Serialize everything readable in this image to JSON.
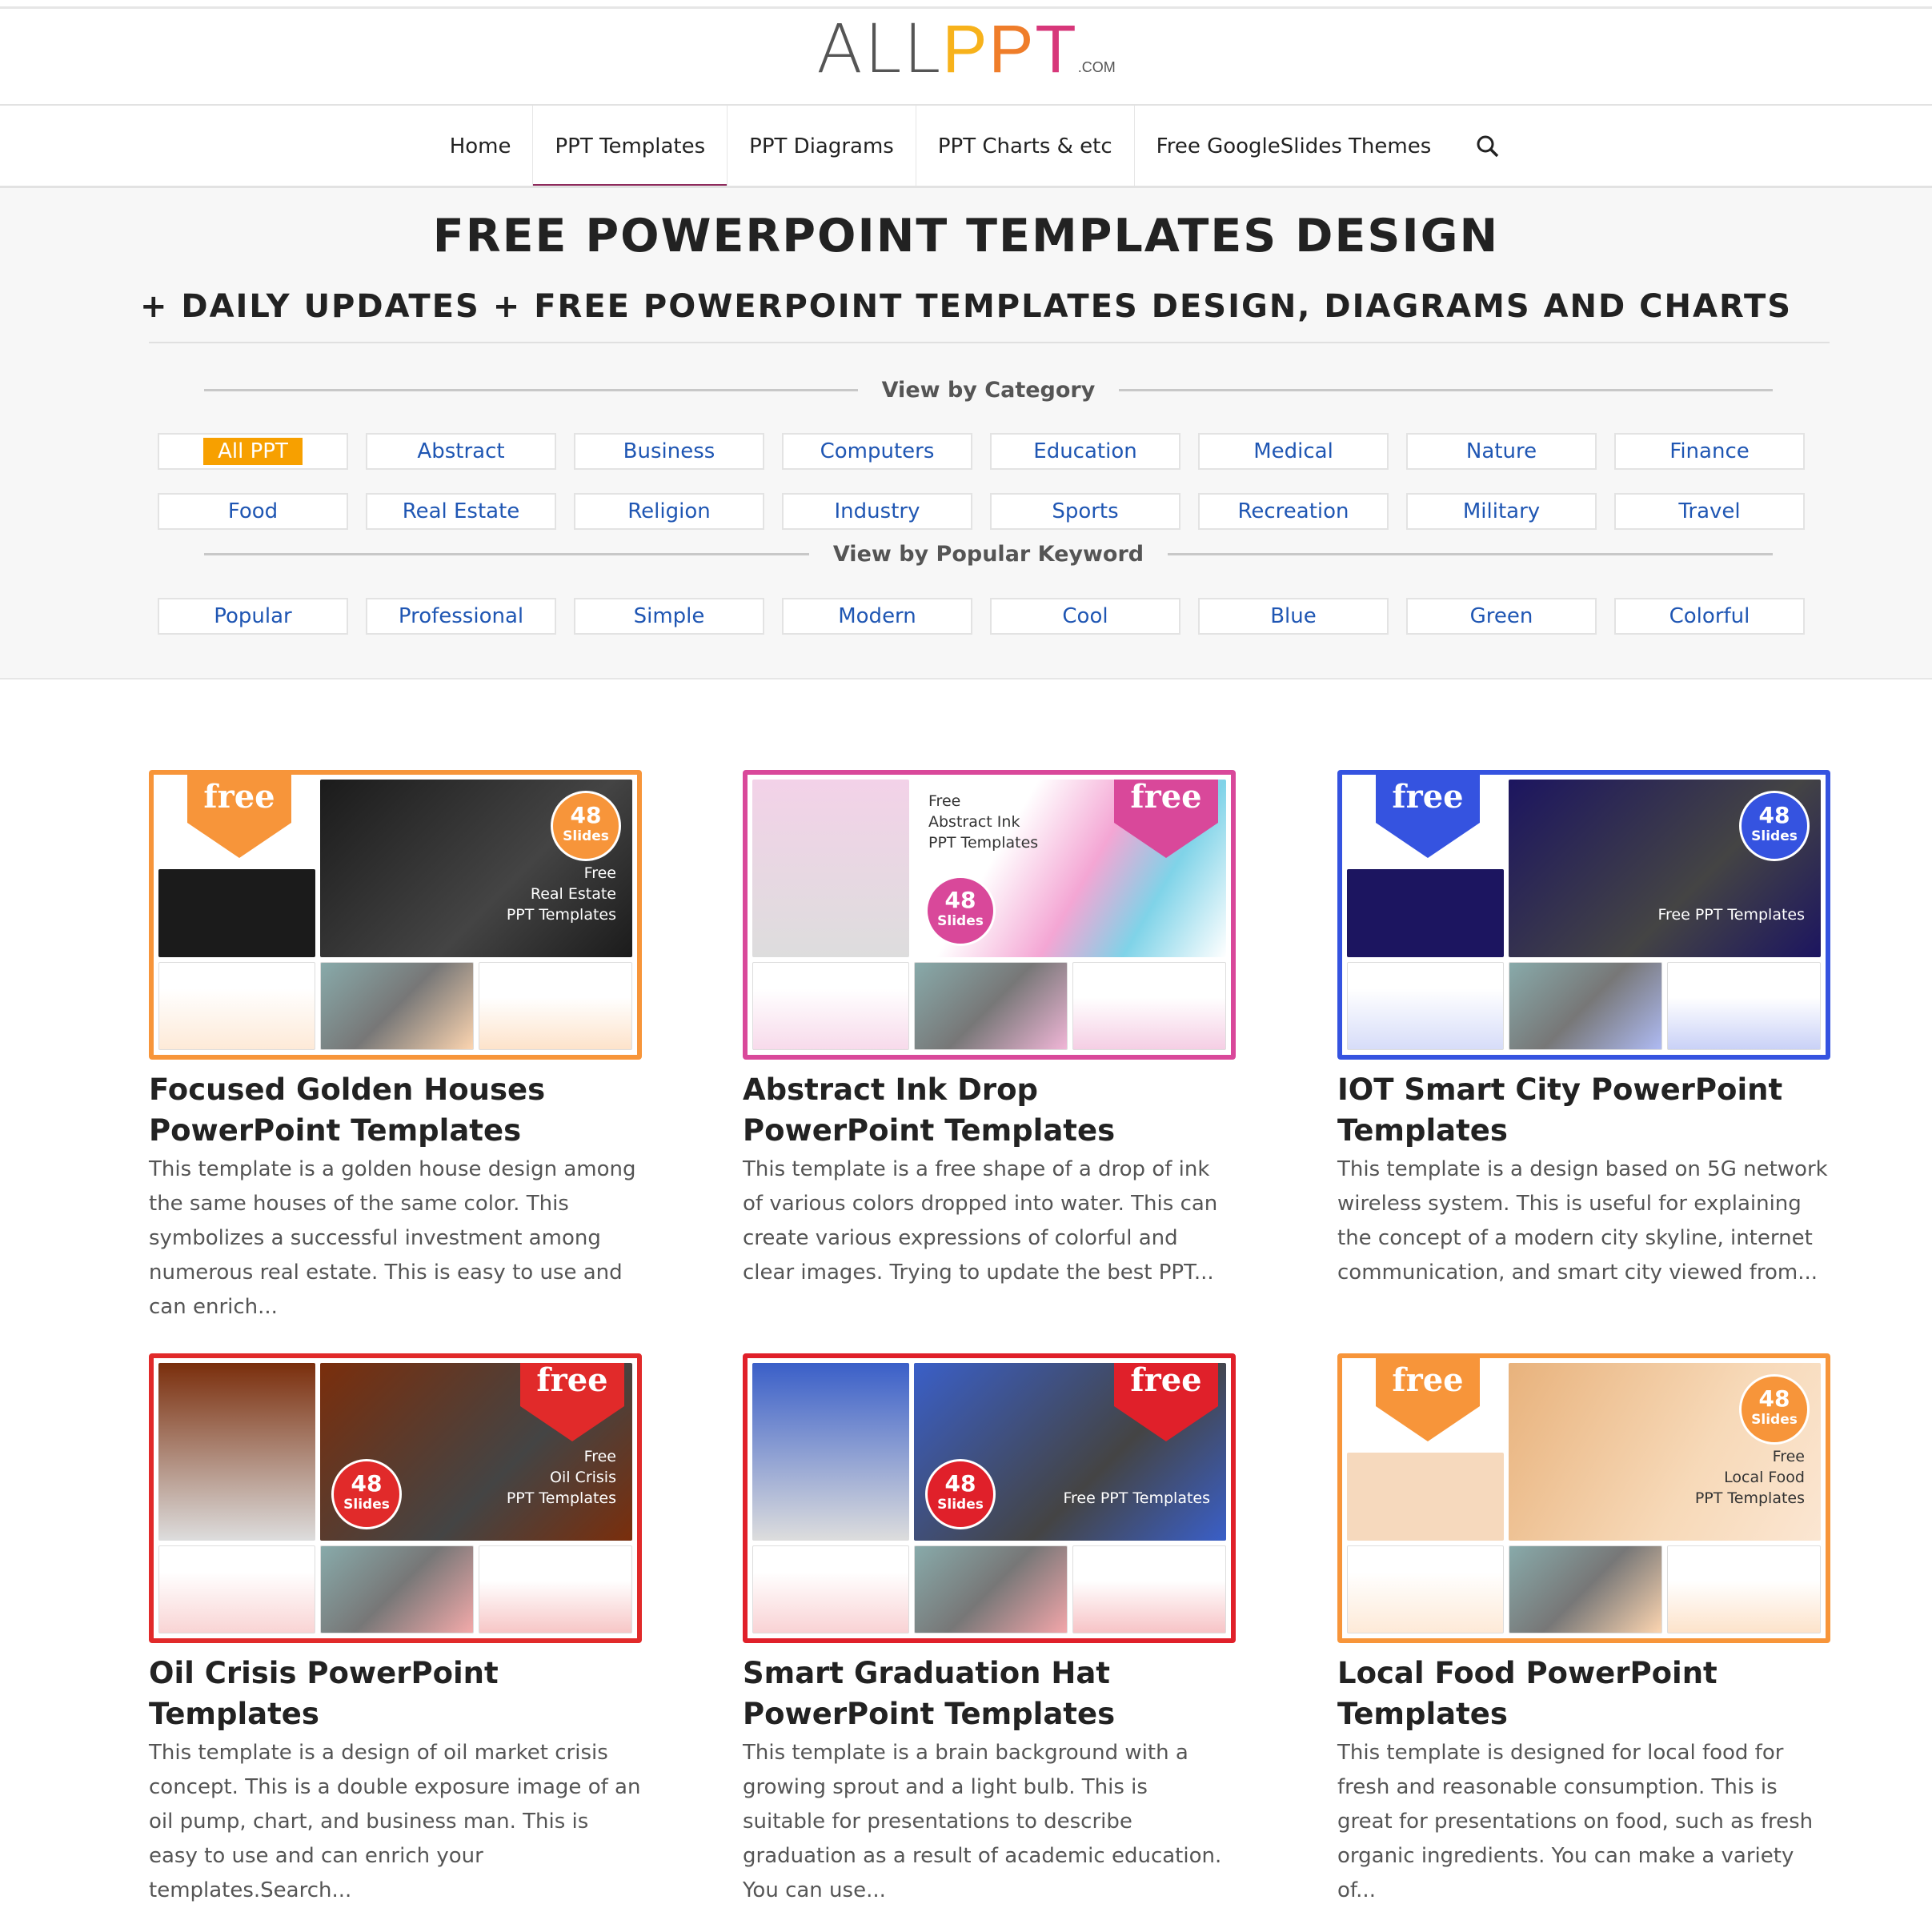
{
  "logo": {
    "all": "ALL",
    "p1": "P",
    "p2": "P",
    "t": "T",
    "com": ".COM"
  },
  "nav": {
    "items": [
      "Home",
      "PPT Templates",
      "PPT Diagrams",
      "PPT Charts & etc",
      "Free GoogleSlides Themes"
    ],
    "active": "PPT Templates",
    "search_icon": "search-icon"
  },
  "hero": {
    "title": "FREE POWERPOINT TEMPLATES DESIGN",
    "subtitle": "+ DAILY UPDATES + FREE POWERPOINT TEMPLATES DESIGN, DIAGRAMS AND CHARTS"
  },
  "category": {
    "label": "View by Category",
    "items": [
      "All PPT",
      "Abstract",
      "Business",
      "Computers",
      "Education",
      "Medical",
      "Nature",
      "Finance",
      "Food",
      "Real Estate",
      "Religion",
      "Industry",
      "Sports",
      "Recreation",
      "Military",
      "Travel"
    ],
    "selected": "All PPT"
  },
  "keyword": {
    "label": "View by Popular Keyword",
    "items": [
      "Popular",
      "Professional",
      "Simple",
      "Modern",
      "Cool",
      "Blue",
      "Green",
      "Colorful"
    ]
  },
  "colors": {
    "accent": "#8e2a5c",
    "link": "#1f56b3",
    "selected": "#f7a000"
  },
  "cards": [
    {
      "title": "Focused Golden Houses PowerPoint Templates",
      "desc": "This template is a golden house design among the same houses of the same color. This symbolizes a successful investment among numerous real estate. This is easy to use and can enrich...",
      "badge": "free",
      "slides": "48",
      "slides_label": "Slides",
      "slide_text": "Free\nReal Estate\nPPT Templates",
      "color": "#f7953a",
      "dark": "#1b1b1b",
      "badge_side": "left"
    },
    {
      "title": "Abstract Ink Drop PowerPoint Templates",
      "desc": "This template is a free shape of a drop of ink of various colors dropped into water. This can create various expressions of colorful and clear images. Trying to update the best PPT...",
      "badge": "free",
      "slides": "48",
      "slides_label": "Slides",
      "slide_text": "Free\nAbstract Ink\nPPT Templates",
      "color": "#d9489a",
      "dark": "#f3d2e8",
      "badge_side": "right"
    },
    {
      "title": "IOT Smart City PowerPoint Templates",
      "desc": "This template is a design based on 5G network wireless system. This is useful for explaining the concept of a modern city skyline, internet communication, and smart city viewed from...",
      "badge": "free",
      "slides": "48",
      "slides_label": "Slides",
      "slide_text": "Free PPT Templates",
      "color": "#3553e0",
      "dark": "#1c1560",
      "badge_side": "left"
    },
    {
      "title": "Oil Crisis PowerPoint Templates",
      "desc": "This template is a design of oil market crisis concept. This is a double exposure image of an oil pump, chart, and business man. This is easy to use and can enrich your templates.Search...",
      "badge": "free",
      "slides": "48",
      "slides_label": "Slides",
      "slide_text": "Free\nOil Crisis\nPPT Templates",
      "color": "#e12a2a",
      "dark": "#7a2e0c",
      "badge_side": "right"
    },
    {
      "title": "Smart Graduation Hat PowerPoint Templates",
      "desc": "This template is a brain background with a growing sprout and a light bulb. This is suitable for presentations to describe graduation as a result of academic education. You can use...",
      "badge": "free",
      "slides": "48",
      "slides_label": "Slides",
      "slide_text": "Free PPT Templates",
      "color": "#e0202a",
      "dark": "#3a5fc8",
      "badge_side": "right"
    },
    {
      "title": "Local Food PowerPoint Templates",
      "desc": "This template is designed for local food for fresh and reasonable consumption. This is great for presentations on food, such as fresh organic ingredients. You can make a variety of...",
      "badge": "free",
      "slides": "48",
      "slides_label": "Slides",
      "slide_text": "Free\nLocal Food\nPPT Templates",
      "color": "#f7953a",
      "dark": "#f6d9bd",
      "badge_side": "left"
    }
  ]
}
